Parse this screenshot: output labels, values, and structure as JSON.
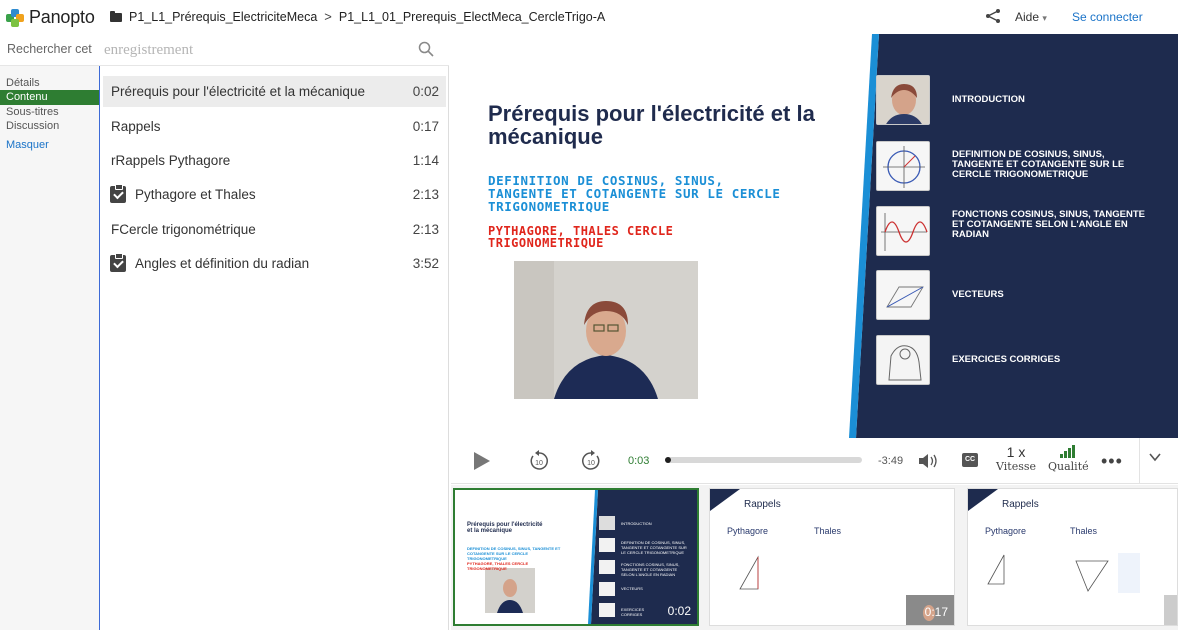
{
  "app": {
    "logo_text": "Panopto"
  },
  "breadcrumb": {
    "folder": "P1_L1_Prérequis_ElectriciteMeca",
    "separator": ">",
    "session": "P1_L1_01_Prerequis_ElectMeca_CercleTrigo-A"
  },
  "header": {
    "help_label": "Aide",
    "help_caret": "▾",
    "signin_label": "Se connecter"
  },
  "search": {
    "label": "Rechercher cet",
    "placeholder": "enregistrement"
  },
  "nav": {
    "details": "Détails",
    "contents": "Contenu",
    "captions": "Sous-titres",
    "discussion": "Discussion",
    "hide": "Masquer"
  },
  "contents": [
    {
      "title": "Prérequis pour l'électricité et la mécanique",
      "time": "0:02",
      "icon": "",
      "selected": true
    },
    {
      "title": "Rappels",
      "time": "0:17",
      "icon": ""
    },
    {
      "title": "rRappels Pythagore",
      "time": "1:14",
      "icon": ""
    },
    {
      "title": "Pythagore et Thales",
      "time": "2:13",
      "icon": "clipboard-check-icon"
    },
    {
      "title": "FCercle trigonométrique",
      "time": "2:13",
      "icon": ""
    },
    {
      "title": "Angles et définition du radian",
      "time": "3:52",
      "icon": "clipboard-check-icon"
    }
  ],
  "slide": {
    "title": "Prérequis pour l'électricité et la mécanique",
    "subtitle": "DEFINITION DE COSINUS, SINUS, TANGENTE ET COTANGENTE SUR LE CERCLE TRIGONOMETRIQUE",
    "subtitle2": "PYTHAGORE, THALES CERCLE TRIGONOMETRIQUE",
    "toc": [
      {
        "label": "INTRODUCTION"
      },
      {
        "label": "DEFINITION DE COSINUS, SINUS, TANGENTE ET COTANGENTE SUR LE CERCLE TRIGONOMETRIQUE"
      },
      {
        "label": "FONCTIONS COSINUS, SINUS, TANGENTE ET COTANGENTE SELON L'ANGLE EN RADIAN"
      },
      {
        "label": "VECTEURS"
      },
      {
        "label": "EXERCICES CORRIGES"
      }
    ],
    "colors": {
      "navy": "#1e2b4e",
      "accent_blue": "#1b8fd6",
      "accent_red": "#e0261c"
    }
  },
  "player": {
    "current_time": "0:03",
    "remaining_time": "-3:49",
    "progress": 0.013,
    "cc_label": "CC",
    "speed_value": "1 x",
    "speed_caption": "Vitesse",
    "quality_caption": "Qualité",
    "more_label": "•••",
    "skip_back_label": "10",
    "skip_forward_label": "10",
    "accent": "#2e7d32"
  },
  "thumbnails": [
    {
      "time": "0:02",
      "mini_title": "Prérequis pour l'électricité et la mécanique",
      "mini_sub": "DEFINITION DE COSINUS, SINUS, TANGENTE ET COTANGENTE SUR LE CERCLE TRIGONOMETRIQUE",
      "mini_sub2": "PYTHAGORE, THALES CERCLE TRIGONOMETRIQUE",
      "toc": [
        "INTRODUCTION",
        "DEFINITION DE COSINUS, SINUS, TANGENTE ET COTANGENTE SUR LE CERCLE TRIGONOMETRIQUE",
        "FONCTIONS COSINUS, SINUS, TANGENTE ET COTANGENTE SELON L'ANGLE EN RADIAN",
        "VECTEURS",
        "EXERCICES CORRIGES"
      ]
    },
    {
      "time": "0:17",
      "heading": "Rappels",
      "col1": "Pythagore",
      "col2": "Thales"
    },
    {
      "time": "",
      "heading": "Rappels",
      "col1": "Pythagore",
      "col2": "Thales"
    }
  ]
}
